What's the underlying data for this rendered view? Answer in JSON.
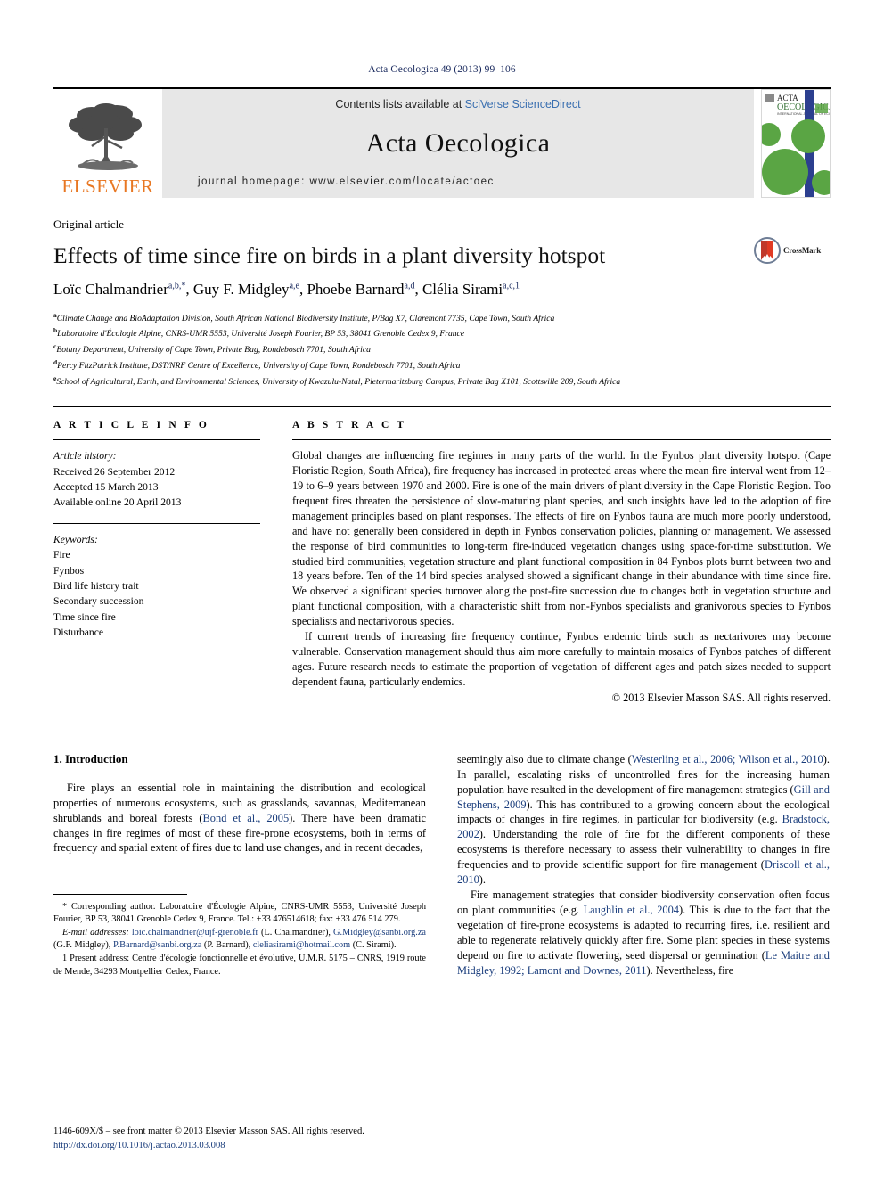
{
  "running_head": "Acta Oecologica 49 (2013) 99–106",
  "masthead": {
    "publisher_name": "ELSEVIER",
    "contents_prefix": "Contents lists available at ",
    "contents_link": "SciVerse ScienceDirect",
    "journal_name": "Acta Oecologica",
    "homepage": "journal homepage: www.elsevier.com/locate/actoec",
    "cover": {
      "line1": "ACTA",
      "line2": "OECOLOGICA",
      "line3": "INTERNATIONAL JOURNAL OF ECOLOGY"
    }
  },
  "article": {
    "type": "Original article",
    "title": "Effects of time since fire on birds in a plant diversity hotspot",
    "crossmark_label": "CrossMark",
    "authors": [
      {
        "name": "Loïc Chalmandrier",
        "sup": "a,b,*"
      },
      {
        "name": "Guy F. Midgley",
        "sup": "a,e"
      },
      {
        "name": "Phoebe Barnard",
        "sup": "a,d"
      },
      {
        "name": "Clélia Sirami",
        "sup": "a,c,1"
      }
    ],
    "affiliations": [
      {
        "mark": "a",
        "text": "Climate Change and BioAdaptation Division, South African National Biodiversity Institute, P/Bag X7, Claremont 7735, Cape Town, South Africa"
      },
      {
        "mark": "b",
        "text": "Laboratoire d'Écologie Alpine, CNRS-UMR 5553, Université Joseph Fourier, BP 53, 38041 Grenoble Cedex 9, France"
      },
      {
        "mark": "c",
        "text": "Botany Department, University of Cape Town, Private Bag, Rondebosch 7701, South Africa"
      },
      {
        "mark": "d",
        "text": "Percy FitzPatrick Institute, DST/NRF Centre of Excellence, University of Cape Town, Rondebosch 7701, South Africa"
      },
      {
        "mark": "e",
        "text": "School of Agricultural, Earth, and Environmental Sciences, University of Kwazulu-Natal, Pietermaritzburg Campus, Private Bag X101, Scottsville 209, South Africa"
      }
    ]
  },
  "article_info": {
    "heading": "A R T I C L E    I N F O",
    "history_label": "Article history:",
    "history": [
      "Received 26 September 2012",
      "Accepted 15 March 2013",
      "Available online 20 April 2013"
    ],
    "keywords_label": "Keywords:",
    "keywords": [
      "Fire",
      "Fynbos",
      "Bird life history trait",
      "Secondary succession",
      "Time since fire",
      "Disturbance"
    ]
  },
  "abstract": {
    "heading": "A B S T R A C T",
    "paragraph_1": "Global changes are influencing fire regimes in many parts of the world. In the Fynbos plant diversity hotspot (Cape Floristic Region, South Africa), fire frequency has increased in protected areas where the mean fire interval went from 12–19 to 6–9 years between 1970 and 2000. Fire is one of the main drivers of plant diversity in the Cape Floristic Region. Too frequent fires threaten the persistence of slow-maturing plant species, and such insights have led to the adoption of fire management principles based on plant responses. The effects of fire on Fynbos fauna are much more poorly understood, and have not generally been considered in depth in Fynbos conservation policies, planning or management. We assessed the response of bird communities to long-term fire-induced vegetation changes using space-for-time substitution. We studied bird communities, vegetation structure and plant functional composition in 84 Fynbos plots burnt between two and 18 years before. Ten of the 14 bird species analysed showed a significant change in their abundance with time since fire. We observed a significant species turnover along the post-fire succession due to changes both in vegetation structure and plant functional composition, with a characteristic shift from non-Fynbos specialists and granivorous species to Fynbos specialists and nectarivorous species.",
    "paragraph_2": "If current trends of increasing fire frequency continue, Fynbos endemic birds such as nectarivores may become vulnerable. Conservation management should thus aim more carefully to maintain mosaics of Fynbos patches of different ages. Future research needs to estimate the proportion of vegetation of different ages and patch sizes needed to support dependent fauna, particularly endemics.",
    "copyright": "© 2013 Elsevier Masson SAS. All rights reserved."
  },
  "introduction": {
    "heading": "1. Introduction",
    "left_paragraph_1_a": "Fire plays an essential role in maintaining the distribution and ecological properties of numerous ecosystems, such as grasslands, savannas, Mediterranean shrublands and boreal forests (",
    "left_ref_1": "Bond et al., 2005",
    "left_paragraph_1_b": "). There have been dramatic changes in fire regimes of most of these fire-prone ecosystems, both in terms of frequency and spatial extent of fires due to land use changes, and in recent decades,",
    "right_p1_a": "seemingly also due to climate change (",
    "right_ref_1": "Westerling et al., 2006; Wilson et al., 2010",
    "right_p1_b": "). In parallel, escalating risks of uncontrolled fires for the increasing human population have resulted in the development of fire management strategies (",
    "right_ref_2": "Gill and Stephens, 2009",
    "right_p1_c": "). This has contributed to a growing concern about the ecological impacts of changes in fire regimes, in particular for biodiversity (e.g. ",
    "right_ref_3": "Bradstock, 2002",
    "right_p1_d": "). Understanding the role of fire for the different components of these ecosystems is therefore necessary to assess their vulnerability to changes in fire frequencies and to provide scientific support for fire management (",
    "right_ref_4": "Driscoll et al., 2010",
    "right_p1_e": ").",
    "right_p2_a": "Fire management strategies that consider biodiversity conservation often focus on plant communities (e.g. ",
    "right_ref_5": "Laughlin et al., 2004",
    "right_p2_b": "). This is due to the fact that the vegetation of fire-prone ecosystems is adapted to recurring fires, i.e. resilient and able to regenerate relatively quickly after fire. Some plant species in these systems depend on fire to activate flowering, seed dispersal or germination (",
    "right_ref_6": "Le Maitre and Midgley, 1992; Lamont and Downes, 2011",
    "right_p2_c": "). Nevertheless, fire"
  },
  "footnotes": {
    "corresponding_a": "* Corresponding author. Laboratoire d'Écologie Alpine, CNRS-UMR 5553, Université Joseph Fourier, BP 53, 38041 Grenoble Cedex 9, France. Tel.: +33 476514618; fax: +33 476 514 279.",
    "email_label": "E-mail addresses:",
    "emails": [
      {
        "address": "loic.chalmandrier@ujf-grenoble.fr",
        "person": "(L. Chalmandrier),"
      },
      {
        "address": "G.Midgley@sanbi.org.za",
        "person": "(G.F. Midgley),"
      },
      {
        "address": "P.Barnard@sanbi.org.za",
        "person": "(P. Barnard),"
      },
      {
        "address": "cleliasirami@hotmail.com",
        "person": "(C. Sirami)."
      }
    ],
    "present_address": "1 Present address: Centre d'écologie fonctionnelle et évolutive, U.M.R. 5175 – CNRS, 1919 route de Mende, 34293 Montpellier Cedex, France."
  },
  "footer": {
    "issn_line": "1146-609X/$ – see front matter © 2013 Elsevier Masson SAS. All rights reserved.",
    "doi_line": "http://dx.doi.org/10.1016/j.actao.2013.03.008"
  },
  "colors": {
    "elsevier_orange": "#E87722",
    "link_blue": "#1a3d7c",
    "sciencedirect_blue": "#3a6fb0",
    "masthead_gray": "#e7e7e7",
    "cover_green": "#5aa544",
    "cover_blue": "#2c3f8f"
  }
}
